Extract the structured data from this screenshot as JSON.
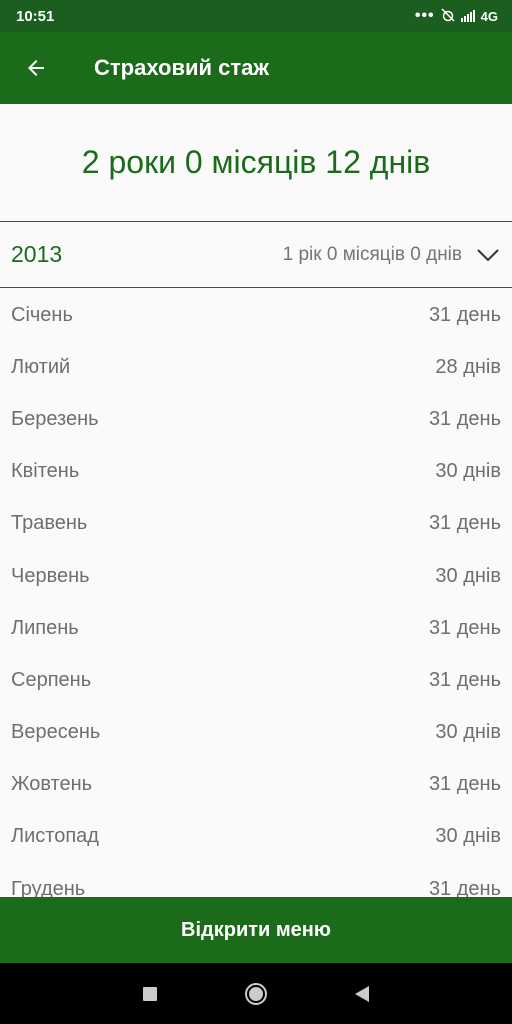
{
  "status_bar": {
    "time": "10:51",
    "dots": "•••",
    "network": "4G"
  },
  "app_bar": {
    "title": "Страховий стаж"
  },
  "summary": {
    "total": "2 роки 0 місяців 12 днів"
  },
  "year_section": {
    "year": "2013",
    "total": "1 рік 0 місяців 0 днів"
  },
  "months": [
    {
      "name": "Січень",
      "days": "31 день"
    },
    {
      "name": "Лютий",
      "days": "28 днів"
    },
    {
      "name": "Березень",
      "days": "31 день"
    },
    {
      "name": "Квітень",
      "days": "30 днів"
    },
    {
      "name": "Травень",
      "days": "31 день"
    },
    {
      "name": "Червень",
      "days": "30 днів"
    },
    {
      "name": "Липень",
      "days": "31 день"
    },
    {
      "name": "Серпень",
      "days": "31 день"
    },
    {
      "name": "Вересень",
      "days": "30 днів"
    },
    {
      "name": "Жовтень",
      "days": "31 день"
    },
    {
      "name": "Листопад",
      "days": "30 днів"
    },
    {
      "name": "Грудень",
      "days": "31 день"
    }
  ],
  "bottom_button": {
    "label": "Відкрити меню"
  },
  "colors": {
    "primary": "#1b6b1b",
    "status_bar": "#1b5e20",
    "text_secondary": "#6f6f6f"
  }
}
